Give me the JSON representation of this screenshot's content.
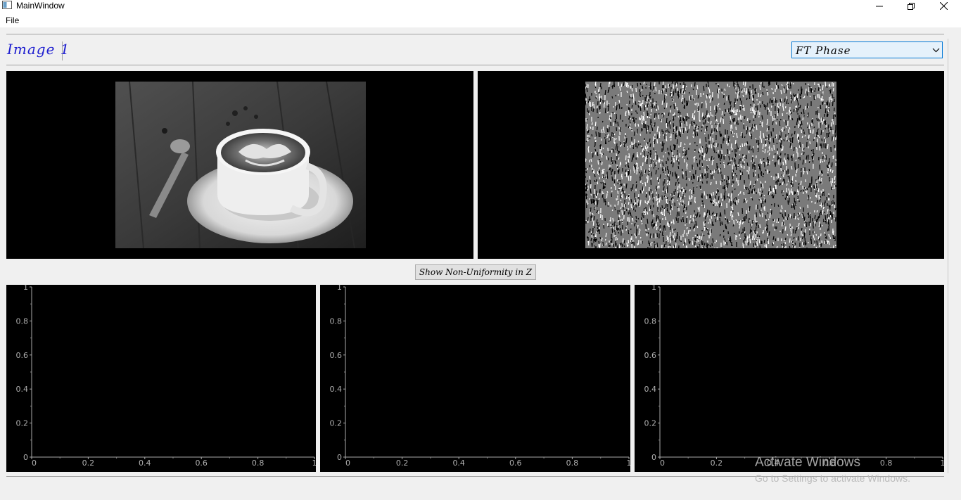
{
  "window": {
    "title": "MainWindow",
    "controls": {
      "minimize_icon": "minimize-icon",
      "maximize_icon": "restore-icon",
      "close_icon": "close-icon"
    }
  },
  "menu": {
    "file_label": "File"
  },
  "header": {
    "image_label": "Image 1"
  },
  "view_select": {
    "selected": "FT Phase"
  },
  "buttons": {
    "non_uniformity": "Show Non-Uniformity in Z"
  },
  "plots": {
    "y_ticks": [
      "1",
      "0.8",
      "0.6",
      "0.4",
      "0.2",
      "0"
    ],
    "x_ticks": [
      "0",
      "0.2",
      "0.4",
      "0.6",
      "0.8",
      "1"
    ]
  },
  "watermark": {
    "line1": "Activate Windows",
    "line2": "Go to Settings to activate Windows."
  }
}
